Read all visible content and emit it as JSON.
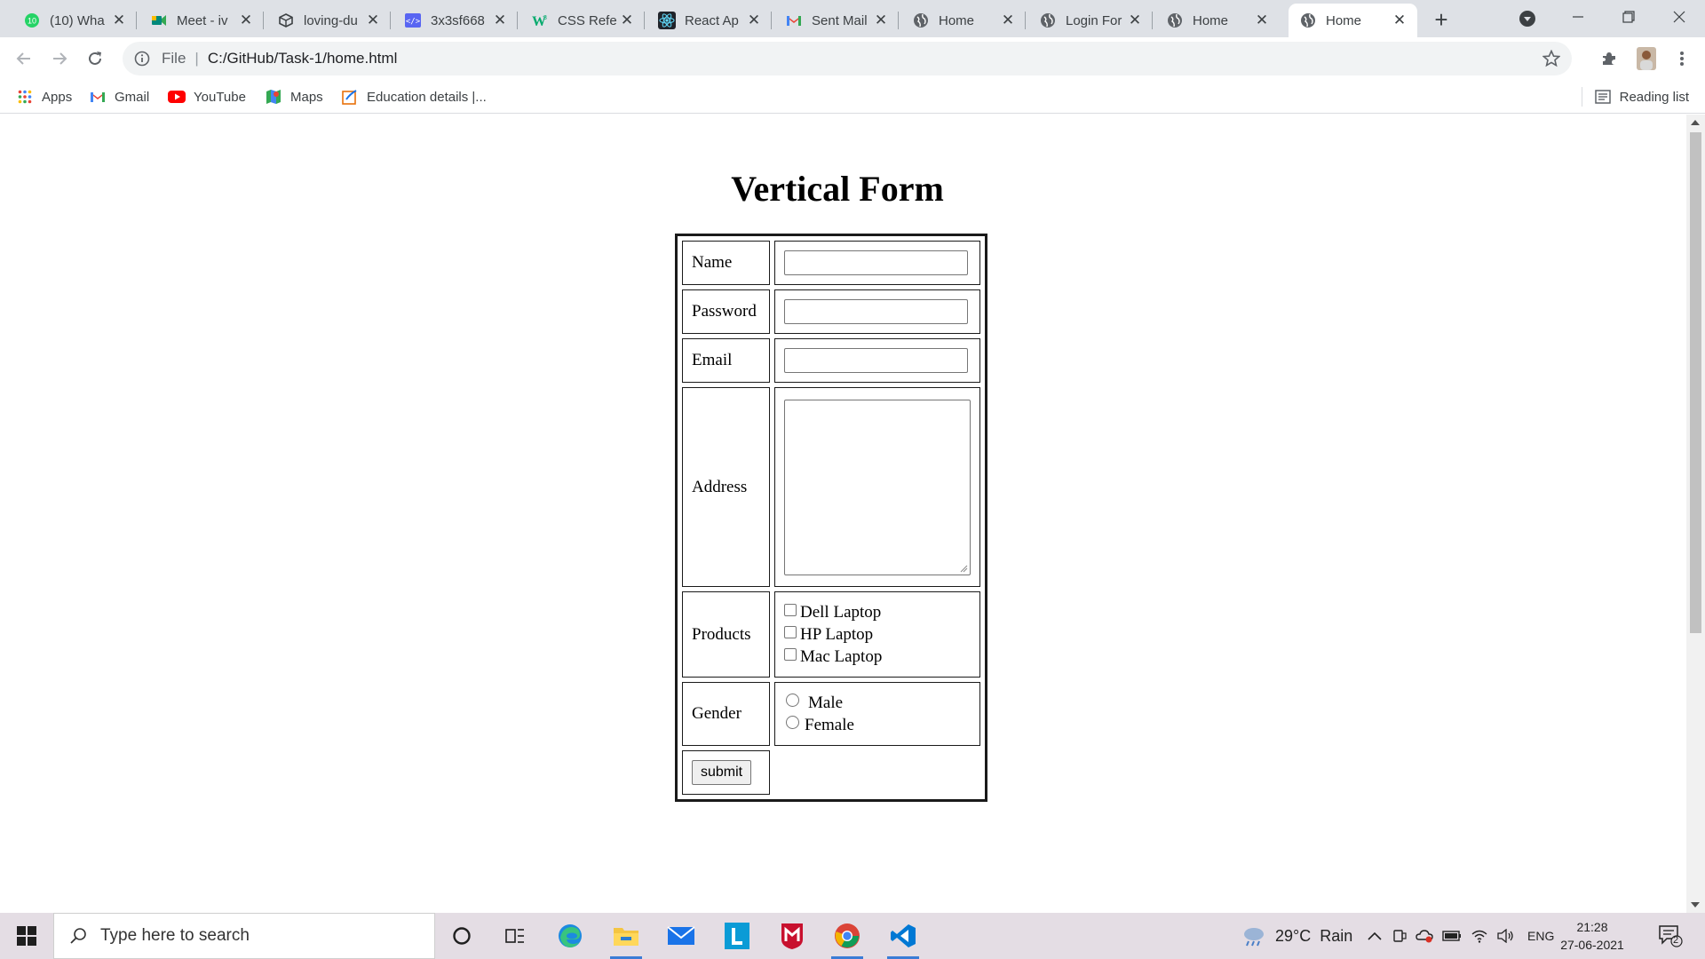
{
  "browser": {
    "tabs": [
      {
        "title": "(10) Wha",
        "icon": "whatsapp-icon",
        "badge": "10"
      },
      {
        "title": "Meet - iv",
        "icon": "google-meet-icon"
      },
      {
        "title": "loving-du",
        "icon": "codesandbox-icon"
      },
      {
        "title": "3x3sf668",
        "icon": "code-icon"
      },
      {
        "title": "CSS Refe",
        "icon": "w3schools-icon"
      },
      {
        "title": "React Ap",
        "icon": "react-icon"
      },
      {
        "title": "Sent Mail",
        "icon": "gmail-icon"
      },
      {
        "title": "Home",
        "icon": "globe-icon"
      },
      {
        "title": "Login For",
        "icon": "globe-icon"
      },
      {
        "title": "Home",
        "icon": "globe-icon"
      },
      {
        "title": "Home",
        "icon": "globe-icon",
        "active": true
      }
    ],
    "address": {
      "scheme": "File",
      "url": "C:/GitHub/Task-1/home.html"
    },
    "bookmarks": [
      {
        "label": "Apps",
        "icon": "apps-grid-icon"
      },
      {
        "label": "Gmail",
        "icon": "gmail-icon"
      },
      {
        "label": "YouTube",
        "icon": "youtube-icon"
      },
      {
        "label": "Maps",
        "icon": "maps-icon"
      },
      {
        "label": "Education details |...",
        "icon": "bookmark-page-icon"
      }
    ],
    "reading_list": "Reading list"
  },
  "page": {
    "title": "Vertical Form",
    "labels": {
      "name": "Name",
      "password": "Password",
      "email": "Email",
      "address": "Address",
      "products": "Products",
      "gender": "Gender"
    },
    "products": [
      "Dell Laptop",
      "HP Laptop",
      "Mac Laptop"
    ],
    "genders": [
      "Male",
      "Female"
    ],
    "submit": "submit"
  },
  "taskbar": {
    "search_placeholder": "Type here to search",
    "weather": "29°C  Rain",
    "language": "ENG",
    "time": "21:28",
    "date": "27-06-2021",
    "notification_count": "2"
  },
  "colors": {
    "tabstrip_bg": "#dee1e6",
    "omnibox_bg": "#f1f3f4",
    "taskbar_bg": "#e4dde4",
    "accent_blue": "#1a73e8"
  }
}
